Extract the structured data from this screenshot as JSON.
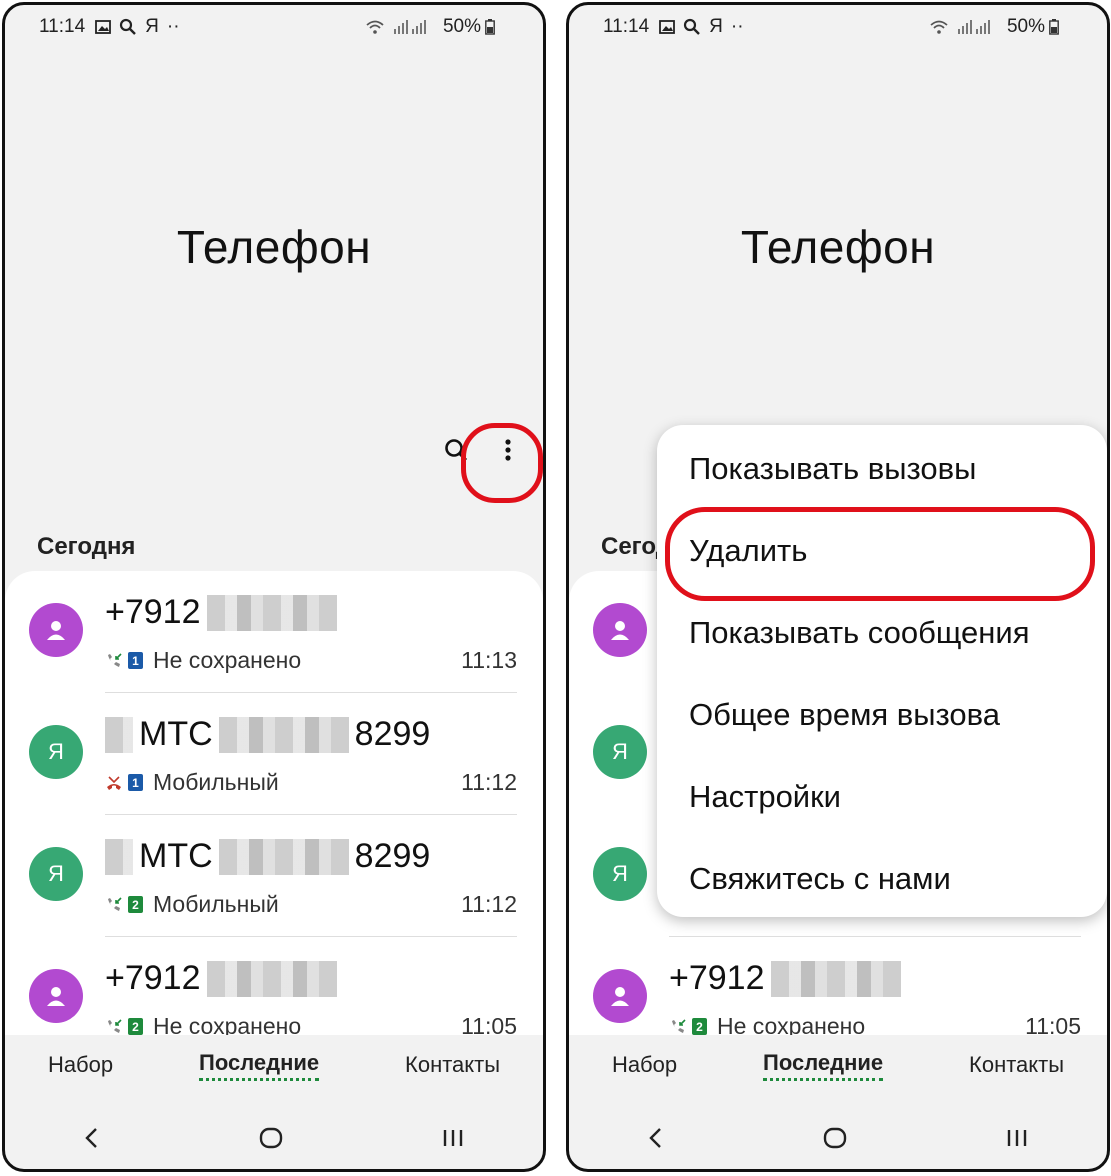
{
  "status": {
    "time": "11:14",
    "battery": "50%",
    "extra": "Я",
    "dots": "··"
  },
  "app": {
    "title": "Телефон"
  },
  "section": "Сегодня",
  "calls": [
    {
      "name_prefix": "+7912",
      "name_suffix": "",
      "sub": "Не сохранено",
      "time": "11:13",
      "avatar": "person-icon",
      "avatar_color": "#b24ad0",
      "sim": "1",
      "call_icon": "incoming-call-icon"
    },
    {
      "name_prefix": "МТС",
      "name_suffix": "8299",
      "sub": "Мобильный",
      "time": "11:12",
      "avatar": "Я",
      "avatar_color": "#37a874",
      "sim": "1",
      "call_icon": "missed-call-icon"
    },
    {
      "name_prefix": "МТС",
      "name_suffix": "8299",
      "sub": "Мобильный",
      "time": "11:12",
      "avatar": "Я",
      "avatar_color": "#37a874",
      "sim": "2",
      "call_icon": "incoming-call-icon"
    },
    {
      "name_prefix": "+7912",
      "name_suffix": "",
      "sub": "Не сохранено",
      "time": "11:05",
      "avatar": "person-icon",
      "avatar_color": "#b24ad0",
      "sim": "2",
      "call_icon": "incoming-call-icon"
    }
  ],
  "nav": {
    "dial": "Набор",
    "recent": "Последние",
    "contacts": "Контакты"
  },
  "menu": {
    "items": [
      "Показывать вызовы",
      "Удалить",
      "Показывать сообщения",
      "Общее время вызова",
      "Настройки",
      "Свяжитесь с нами"
    ]
  },
  "colors": {
    "highlight": "#e0101a",
    "accent": "#1e8a3c"
  }
}
